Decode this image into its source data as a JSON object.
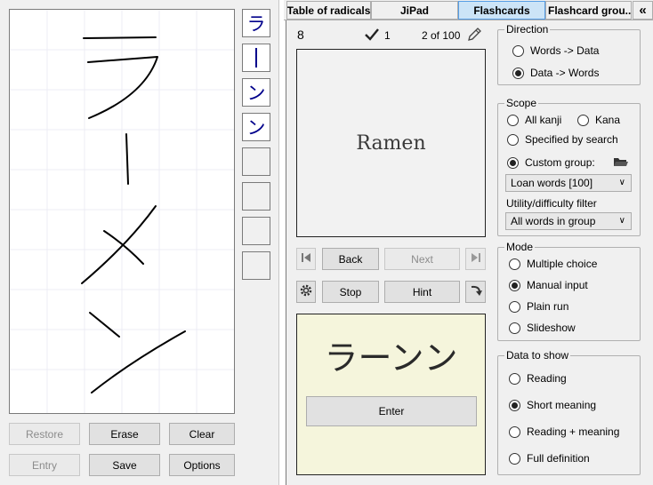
{
  "left_panel": {
    "slots": [
      "ラ",
      "ー",
      "ン",
      "ン",
      "",
      "",
      "",
      ""
    ],
    "buttons": {
      "restore": "Restore",
      "erase": "Erase",
      "clear": "Clear",
      "entry": "Entry",
      "save": "Save",
      "options": "Options"
    }
  },
  "tabs": [
    "Table of radicals",
    "JiPad",
    "Flashcards",
    "Flashcard grou..."
  ],
  "tabs_selected": "Flashcards",
  "flashcard": {
    "count": "8",
    "correct": "1",
    "progress": "2 of 100",
    "question": "Ramen",
    "answer": "ラーンン",
    "enter_label": "Enter",
    "buttons": {
      "back": "Back",
      "next": "Next",
      "stop": "Stop",
      "hint": "Hint"
    }
  },
  "direction": {
    "title": "Direction",
    "options": [
      "Words -> Data",
      "Data -> Words"
    ],
    "selected": "Data -> Words"
  },
  "scope": {
    "title": "Scope",
    "all_kanji": "All kanji",
    "kana": "Kana",
    "specified": "Specified by search",
    "custom_group": "Custom group:",
    "selected": "Custom group:",
    "group_value": "Loan words [100]",
    "filter_label": "Utility/difficulty filter",
    "filter_value": "All words in group"
  },
  "mode": {
    "title": "Mode",
    "options": [
      "Multiple choice",
      "Manual input",
      "Plain run",
      "Slideshow"
    ],
    "selected": "Manual input"
  },
  "data_to_show": {
    "title": "Data to show",
    "options": [
      "Reading",
      "Short meaning",
      "Reading + meaning",
      "Full definition"
    ],
    "selected": "Short meaning"
  },
  "colors": {
    "selected_tab": "#cce4f7",
    "answer_background": "#f5f5dc",
    "kana_ink": "#00008b"
  }
}
